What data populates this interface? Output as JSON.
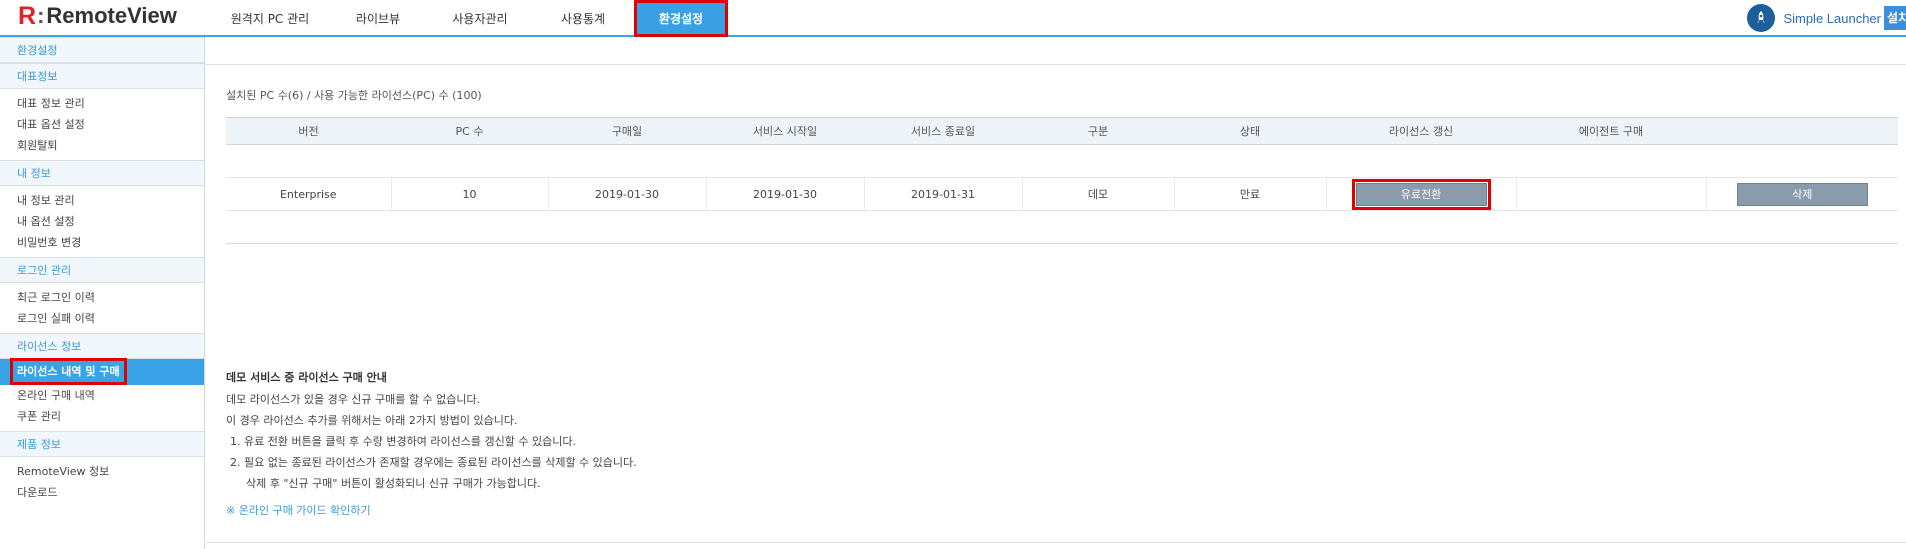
{
  "app": {
    "logo_mark": "R",
    "logo_colon": ":",
    "logo_text": "RemoteView"
  },
  "nav": {
    "items": [
      {
        "label": "원격지 PC 관리"
      },
      {
        "label": "라이브뷰"
      },
      {
        "label": "사용자관리"
      },
      {
        "label": "사용통계"
      },
      {
        "label": "환경설정"
      }
    ],
    "active_index": 4
  },
  "launcher": {
    "label": "Simple Launcher",
    "setup_label": "설치"
  },
  "sidebar": {
    "sections": [
      {
        "header": "환경설정",
        "items": []
      },
      {
        "header": "대표정보",
        "items": [
          {
            "label": "대표 정보 관리"
          },
          {
            "label": "대표 옵션 설정"
          },
          {
            "label": "회원탈퇴"
          }
        ]
      },
      {
        "header": "내 정보",
        "items": [
          {
            "label": "내 정보 관리"
          },
          {
            "label": "내 옵션 설정"
          },
          {
            "label": "비밀번호 변경"
          }
        ]
      },
      {
        "header": "로그인 관리",
        "items": [
          {
            "label": "최근 로그인 이력"
          },
          {
            "label": "로그인 실패 이력"
          }
        ]
      },
      {
        "header": "라이선스 정보",
        "items": [
          {
            "label": "라이선스 내역 및 구매"
          },
          {
            "label": "온라인 구매 내역"
          },
          {
            "label": "쿠폰 관리"
          }
        ]
      },
      {
        "header": "제품 정보",
        "items": [
          {
            "label": "RemoteView 정보"
          },
          {
            "label": "다운로드"
          }
        ]
      }
    ],
    "active_item": "라이선스 내역 및 구매"
  },
  "summary": "설치된 PC 수(6) / 사용 가능한 라이선스(PC) 수 (100)",
  "table": {
    "headers": [
      "버전",
      "PC 수",
      "구매일",
      "서비스 시작일",
      "서비스 종료일",
      "구분",
      "상태",
      "라이선스 갱신",
      "에이전트 구매",
      ""
    ],
    "rows": [
      {
        "version": "Enterprise",
        "pc_count": "10",
        "purchase_date": "2019-01-30",
        "start_date": "2019-01-30",
        "end_date": "2019-01-31",
        "type": "데모",
        "status": "만료",
        "renew_button": "유료전환",
        "agent_purchase": "",
        "delete_button": "삭제"
      }
    ]
  },
  "notice": {
    "title": "데모 서비스 중 라이선스 구매 안내",
    "lines": [
      "데모 라이선스가 있을 경우 신규 구매를 할 수 없습니다.",
      "이 경우 라이선스 추가를 위해서는 아래 2가지 방법이 있습니다.",
      "1. 유료 전환 버튼을 클릭 후 수량 변경하여 라이선스를 갱신할 수 있습니다.",
      "2. 필요 없는 종료된 라이선스가 존재할 경우에는 종료된 라이선스를 삭제할 수 있습니다.",
      "삭제 후 \"신규 구매\" 버튼이 활성화되니 신규 구매가 가능합니다."
    ],
    "link": "※ 온라인 구매 가이드 확인하기"
  },
  "colors": {
    "accent": "#39a0e4",
    "brand_red": "#e4202a",
    "highlight": "#e00000",
    "button_gray": "#8a9bab"
  }
}
